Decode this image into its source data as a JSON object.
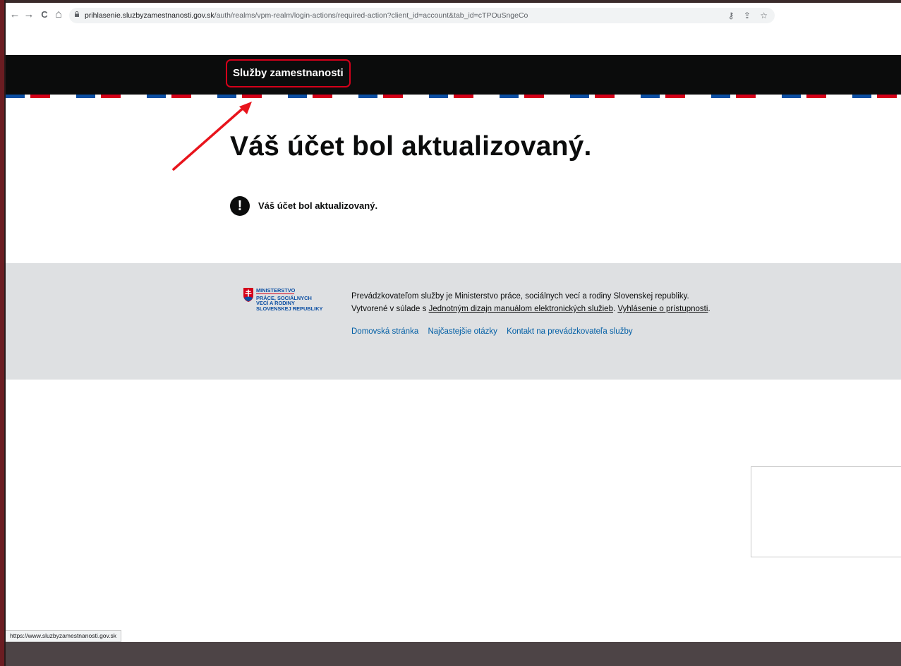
{
  "browser": {
    "back_icon": "←",
    "forward_icon": "→",
    "reload_icon": "C",
    "home_icon": "⌂",
    "url_host": "prihlasenie.sluzbyzamestnanosti.gov.sk",
    "url_path": "/auth/realms/vpm-realm/login-actions/required-action?client_id=account&tab_id=cTPOuSngeCo",
    "key_icon": "⚷",
    "share_icon": "⇪",
    "star_icon": "☆",
    "status_url": "https://www.sluzbyzamestnanosti.gov.sk"
  },
  "header": {
    "brand": "Služby zamestnanosti"
  },
  "main": {
    "title": "Váš účet bol aktualizovaný.",
    "notice_icon": "!",
    "notice_text": "Váš účet bol aktualizovaný."
  },
  "footer": {
    "logo_lines": [
      "MINISTERSTVO",
      "PRÁCE, SOCIÁLNYCH",
      "VECÍ A RODINY",
      "SLOVENSKEJ REPUBLIKY"
    ],
    "text_part1": "Prevádzkovateľom služby je Ministerstvo práce, sociálnych vecí a rodiny Slovenskej republiky. Vytvorené v súlade s ",
    "link_manual": "Jednotným dizajn manuálom elektronických služieb",
    "text_part2": ". ",
    "link_accessibility": "Vyhlásenie o prístupnosti",
    "text_part3": ".",
    "links": [
      "Domovská stránka",
      "Najčastejšie otázky",
      "Kontakt na prevádzkovateľa služby"
    ]
  },
  "colors": {
    "header_bg": "#0b0c0c",
    "footer_bg": "#dee0e2",
    "link": "#005ea5",
    "flag_blue": "#0b4ea2",
    "flag_red": "#d4001a",
    "annotation": "#e8141c"
  }
}
